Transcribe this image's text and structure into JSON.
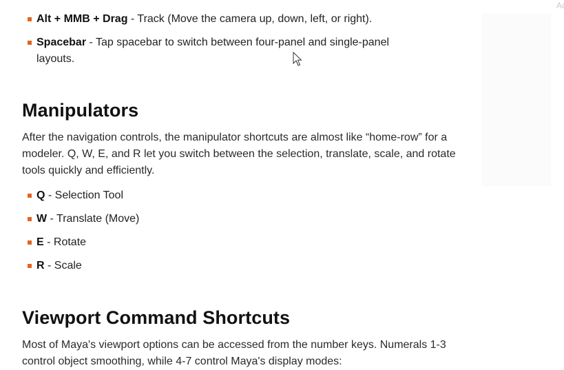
{
  "ad": {
    "label": "Ad"
  },
  "nav_list": [
    {
      "key": "Alt + MMB + Drag",
      "desc": " - Track (Move the camera up, down, left, or right)."
    },
    {
      "key": "Spacebar",
      "desc": " - Tap spacebar to switch between four-panel and single-panel layouts."
    }
  ],
  "manipulators": {
    "heading": "Manipulators",
    "body": "After the navigation controls, the manipulator shortcuts are almost like “home-row” for a modeler. Q, W, E, and R let you switch between the selection, translate, scale, and rotate tools quickly and efficiently.",
    "items": [
      {
        "key": "Q",
        "desc": " - Selection Tool"
      },
      {
        "key": "W",
        "desc": " - Translate (Move)"
      },
      {
        "key": "E",
        "desc": " - Rotate"
      },
      {
        "key": "R",
        "desc": " - Scale"
      }
    ]
  },
  "viewport": {
    "heading": "Viewport Command Shortcuts",
    "body": "Most of Maya's viewport options can be accessed from the number keys. Numerals 1-3 control object smoothing, while 4-7 control Maya's display modes:"
  },
  "colors": {
    "bullet": "#e0661f",
    "text": "#222222"
  },
  "icons": {
    "cursor": "mouse-pointer-icon"
  }
}
